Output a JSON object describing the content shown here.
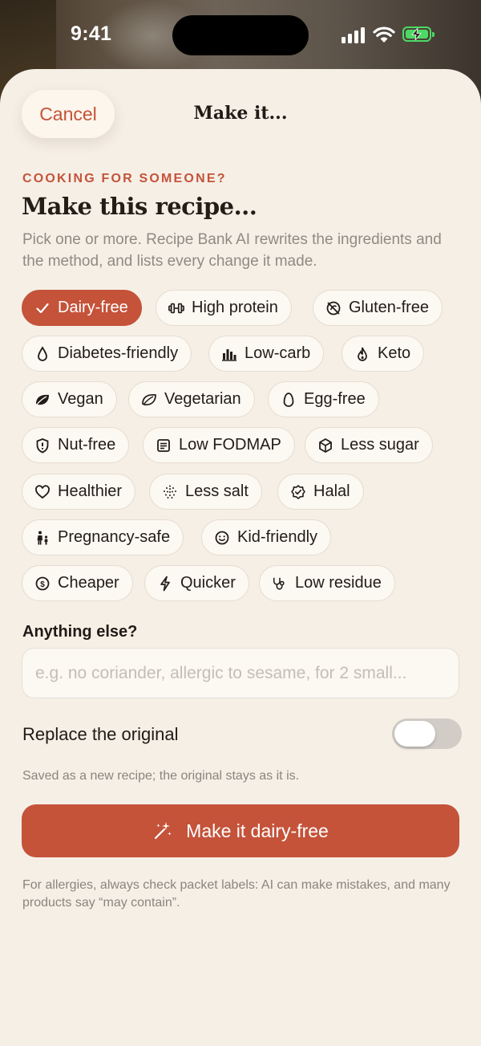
{
  "status_bar": {
    "time": "9:41"
  },
  "header": {
    "cancel_label": "Cancel",
    "title": "Make it..."
  },
  "section": {
    "eyebrow": "COOKING FOR SOMEONE?",
    "heading": "Make this recipe...",
    "description": "Pick one or more. Recipe Bank AI rewrites the ingredients and the method, and lists every change it made."
  },
  "options": [
    {
      "label": "Dairy-free",
      "icon": "check-icon",
      "selected": true
    },
    {
      "label": "High protein",
      "icon": "dumbbell-icon",
      "selected": false
    },
    {
      "label": "Gluten-free",
      "icon": "no-gluten-icon",
      "selected": false
    },
    {
      "label": "Diabetes-friendly",
      "icon": "drop-icon",
      "selected": false
    },
    {
      "label": "Low-carb",
      "icon": "bar-chart-icon",
      "selected": false
    },
    {
      "label": "Keto",
      "icon": "flame-icon",
      "selected": false
    },
    {
      "label": "Vegan",
      "icon": "leaf-icon",
      "selected": false
    },
    {
      "label": "Vegetarian",
      "icon": "leaf-outline-icon",
      "selected": false
    },
    {
      "label": "Egg-free",
      "icon": "egg-icon",
      "selected": false
    },
    {
      "label": "Nut-free",
      "icon": "shield-icon",
      "selected": false
    },
    {
      "label": "Low FODMAP",
      "icon": "list-icon",
      "selected": false
    },
    {
      "label": "Less sugar",
      "icon": "cube-icon",
      "selected": false
    },
    {
      "label": "Healthier",
      "icon": "heart-icon",
      "selected": false
    },
    {
      "label": "Less salt",
      "icon": "dots-icon",
      "selected": false
    },
    {
      "label": "Halal",
      "icon": "badge-icon",
      "selected": false
    },
    {
      "label": "Pregnancy-safe",
      "icon": "family-icon",
      "selected": false
    },
    {
      "label": "Kid-friendly",
      "icon": "smile-icon",
      "selected": false
    },
    {
      "label": "Cheaper",
      "icon": "coin-icon",
      "selected": false
    },
    {
      "label": "Quicker",
      "icon": "bolt-icon",
      "selected": false
    },
    {
      "label": "Low residue",
      "icon": "stethoscope-icon",
      "selected": false
    }
  ],
  "extra": {
    "label": "Anything else?",
    "placeholder": "e.g. no coriander, allergic to sesame, for 2 small...",
    "value": ""
  },
  "replace": {
    "label": "Replace the original",
    "on": false,
    "hint": "Saved as a new recipe; the original stays as it is."
  },
  "cta": {
    "label": "Make it dairy-free",
    "icon": "magic-wand-icon"
  },
  "footnote": "For allergies, always check packet labels: AI can make mistakes, and many products say “may contain”.",
  "colors": {
    "accent": "#c4533a",
    "background": "#f6efe6",
    "chip": "#fcf8f2",
    "text": "#221c17",
    "muted": "#8f8a83"
  }
}
